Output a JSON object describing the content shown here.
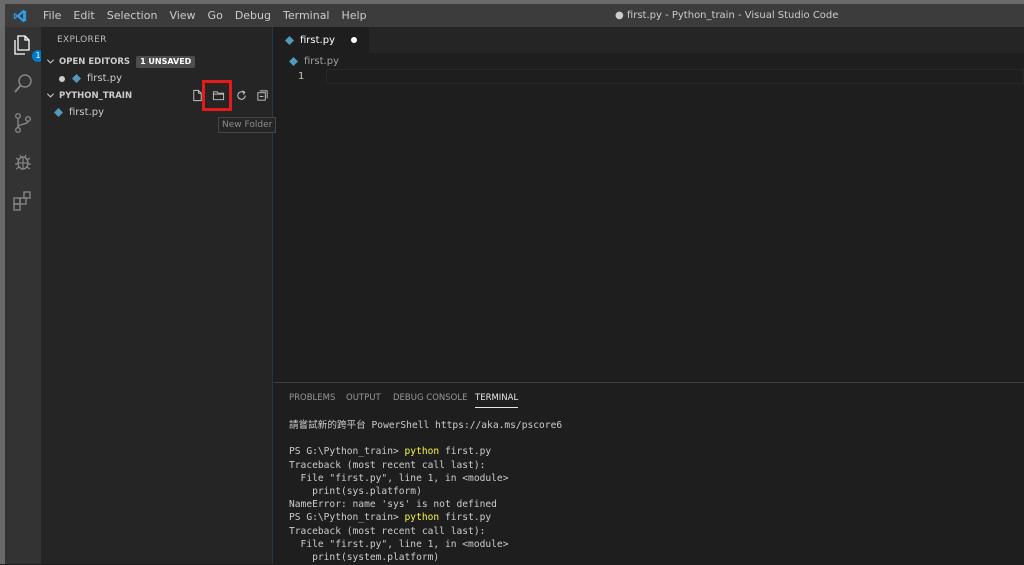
{
  "app": {
    "window_title": "● first.py - Python_train - Visual Studio Code",
    "menu": [
      "File",
      "Edit",
      "Selection",
      "View",
      "Go",
      "Debug",
      "Terminal",
      "Help"
    ],
    "accent": "#007acc"
  },
  "activity": {
    "items": [
      "explorer-icon",
      "search-icon",
      "source-control-icon",
      "debug-icon",
      "extensions-icon"
    ],
    "explorer_badge": "1"
  },
  "sidebar": {
    "title": "EXPLORER",
    "open_editors": {
      "label": "OPEN EDITORS",
      "badge": "1 UNSAVED",
      "file": "first.py"
    },
    "folder": {
      "label": "PYTHON_TRAIN",
      "file": "first.py"
    },
    "toolbar_icons": [
      "new-file-icon",
      "new-folder-icon",
      "refresh-icon",
      "collapse-all-icon"
    ],
    "tooltip": "New Folder"
  },
  "editor": {
    "tab_label": "first.py",
    "breadcrumb": "first.py",
    "line_number": "1"
  },
  "panel": {
    "tabs": [
      "PROBLEMS",
      "OUTPUT",
      "DEBUG CONSOLE",
      "TERMINAL"
    ],
    "active_tab": "TERMINAL",
    "terminal_lines": [
      {
        "text": "請嘗試新的跨平台 PowerShell https://aka.ms/pscore6"
      },
      {
        "text": ""
      },
      {
        "prompt": "PS G:\\Python_train> ",
        "cmd": "python",
        "rest": " first.py"
      },
      {
        "text": "Traceback (most recent call last):"
      },
      {
        "text": "  File \"first.py\", line 1, in <module>"
      },
      {
        "text": "    print(sys.platform)"
      },
      {
        "text": "NameError: name 'sys' is not defined"
      },
      {
        "prompt": "PS G:\\Python_train> ",
        "cmd": "python",
        "rest": " first.py"
      },
      {
        "text": "Traceback (most recent call last):"
      },
      {
        "text": "  File \"first.py\", line 1, in <module>"
      },
      {
        "text": "    print(system.platform)"
      }
    ]
  }
}
